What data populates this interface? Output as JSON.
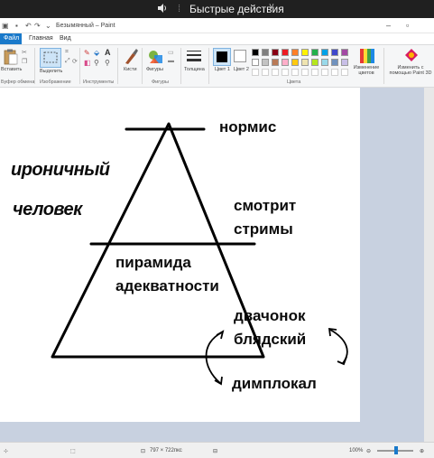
{
  "overlay_bar": {
    "title": "Быстрые действия",
    "chevron": "˅"
  },
  "paint_window": {
    "document_title": "Безымянный – Paint",
    "tabs": [
      {
        "label": "Файл"
      },
      {
        "label": "Главная"
      },
      {
        "label": "Вид"
      }
    ],
    "ribbon": {
      "clipboard_label": "Буфер обмена",
      "paste_label": "Вставить",
      "image_label": "Изображение",
      "select_label": "Выделить",
      "tools_label": "Инструменты",
      "brushes_label": "Кисти",
      "shapes_label": "Фигуры",
      "shapes_group_label": "Фигуры",
      "size_label": "Толщина",
      "color1_label": "Цвет 1",
      "color2_label": "Цвет 2",
      "colors_group_label": "Цвета",
      "edit_colors_label": "Изменение цветов",
      "paint3d_label": "Изменить с помощью Paint 3D",
      "palette": [
        "#000000",
        "#7f7f7f",
        "#880015",
        "#ed1c24",
        "#ff7f27",
        "#fff200",
        "#22b14c",
        "#00a2e8",
        "#3f48cc",
        "#a349a4",
        "#ffffff",
        "#c3c3c3",
        "#b97a57",
        "#ffaec9",
        "#ffc90e",
        "#efe4b0",
        "#b5e61d",
        "#99d9ea",
        "#7092be",
        "#c8bfe7"
      ]
    },
    "canvas": {
      "labels": {
        "top": "нормис",
        "left_line1": "ироничный",
        "left_line2": "человек",
        "middle_line1": "смотрит",
        "middle_line2": "стримы",
        "base_line1": "пирамида",
        "base_line2": "адекватности",
        "right_line1": "двачонок",
        "right_line2": "блядский",
        "bottom": "димплокал"
      }
    },
    "status": {
      "cursor_pos": "",
      "selection_size": "",
      "canvas_size": "797 × 722пкс",
      "file_size": "",
      "zoom": "100%"
    }
  },
  "colors": {
    "file_tab": "#1979ca",
    "workspace": "#c8d1e0",
    "overlay": "#202020"
  }
}
